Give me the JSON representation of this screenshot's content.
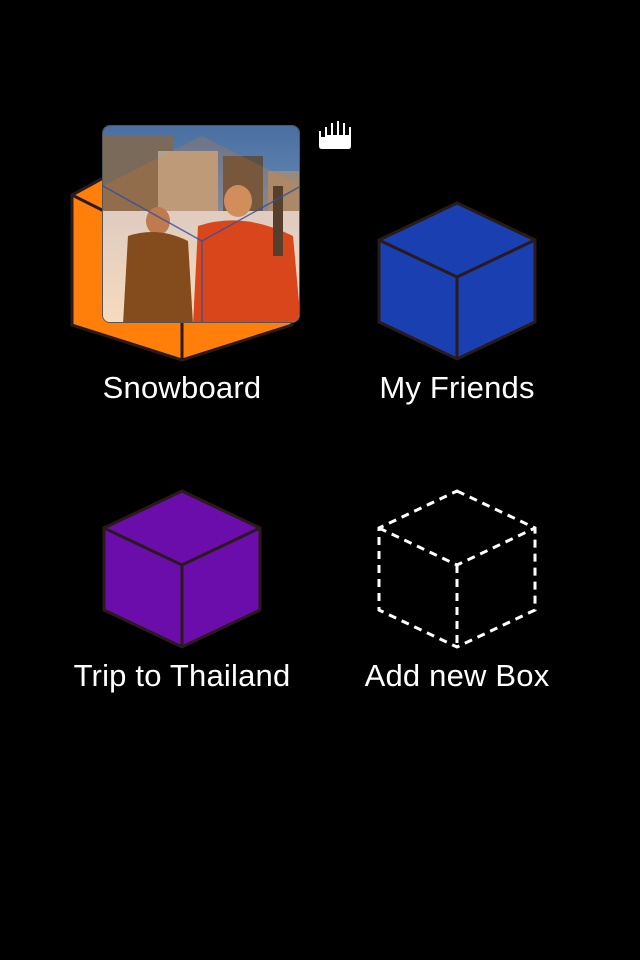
{
  "colors": {
    "background": "#000000",
    "text": "#ffffff",
    "snowboard_cube": "#ff7f0a",
    "friends_cube": "#1a3fb0",
    "thailand_cube": "#6a0dab",
    "cube_edge": "#2a1a1a",
    "add_cube_dashes": "#ffffff"
  },
  "boxes": [
    {
      "label": "Snowboard",
      "icon": "orange-cube-with-photo-icon"
    },
    {
      "label": "My Friends",
      "icon": "blue-cube-icon"
    },
    {
      "label": "Trip to Thailand",
      "icon": "purple-cube-icon"
    },
    {
      "label": "Add new Box",
      "icon": "dashed-cube-icon"
    }
  ],
  "drag_cursor": {
    "icon": "grab-hand-icon"
  }
}
